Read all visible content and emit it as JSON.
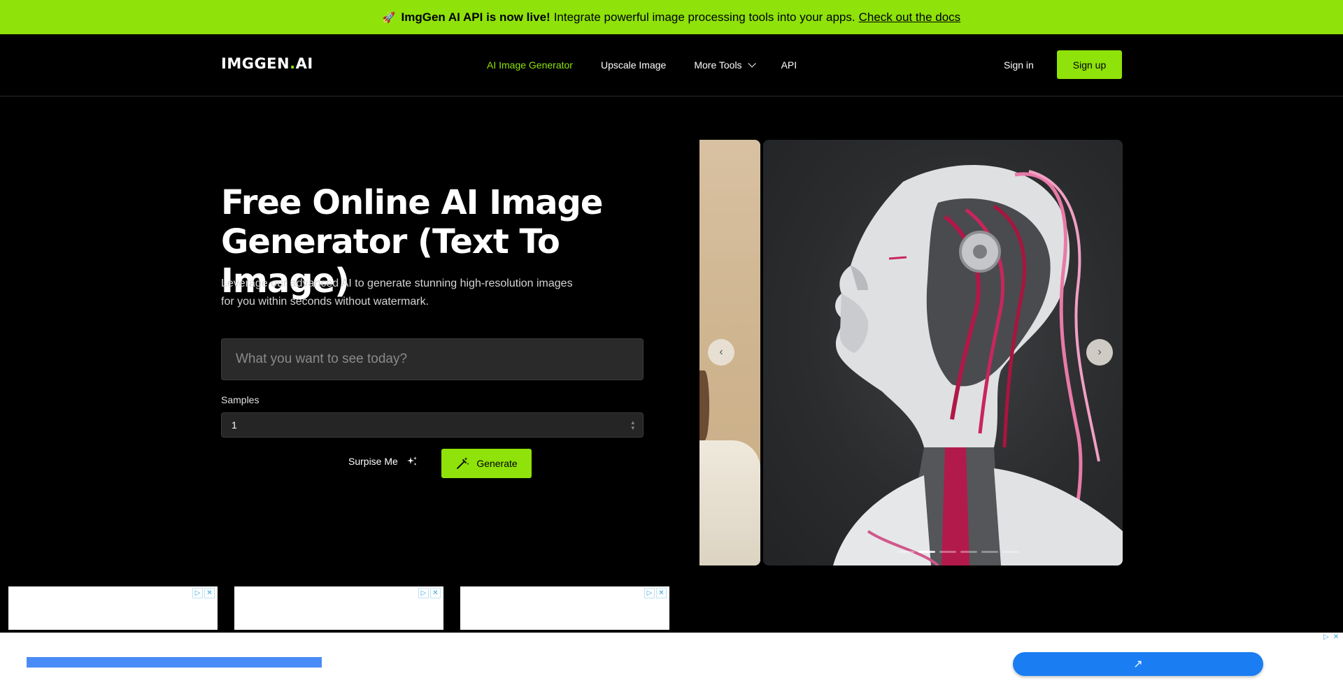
{
  "announcement": {
    "icon": "rocket-icon",
    "bold": "ImgGen AI API is now live!",
    "text": "Integrate powerful image processing tools into your apps.",
    "link": "Check out the docs"
  },
  "header": {
    "logo_main": "IMGGEN",
    "logo_dot": ".",
    "logo_suffix": "AI",
    "nav": [
      {
        "label": "AI Image Generator",
        "active": true
      },
      {
        "label": "Upscale Image"
      },
      {
        "label": "More Tools"
      },
      {
        "label": "API"
      }
    ],
    "sign_in": "Sign in",
    "sign_up": "Sign up"
  },
  "hero": {
    "title": "Free Online AI Image Generator (Text To Image)",
    "subtitle": "Leverage our advanced AI to generate stunning high-resolution images for you within seconds without watermark.",
    "prompt_placeholder": "What you want to see today?",
    "samples_label": "Samples",
    "samples_value": "1",
    "surprise_label": "Surpise Me",
    "generate_label": "Generate"
  },
  "carousel": {
    "prev_icon": "‹",
    "next_icon": "›"
  },
  "bottom_ad": {
    "cta_icon": "↗"
  },
  "colors": {
    "accent": "#8fe20a",
    "background": "#000000"
  }
}
